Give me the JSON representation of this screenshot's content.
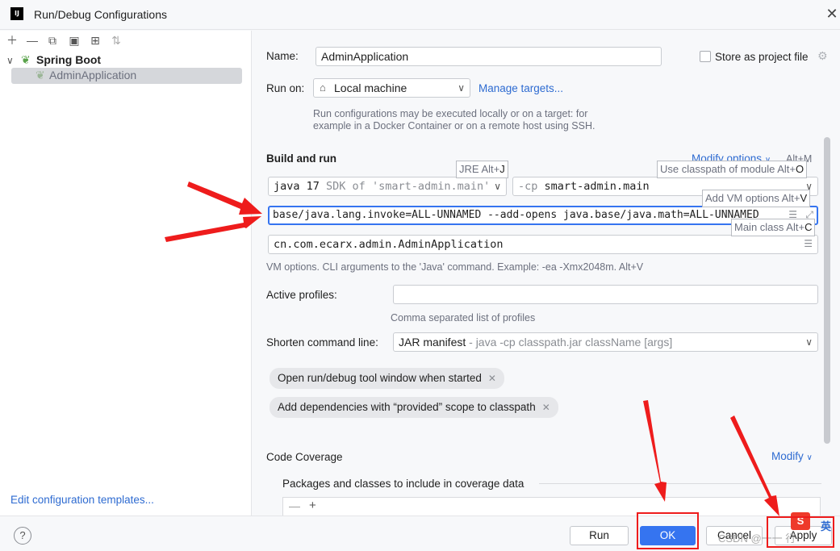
{
  "window": {
    "title": "Run/Debug Configurations",
    "logo_text": "IJ"
  },
  "left": {
    "tree_root": "Spring Boot",
    "tree_child": "AdminApplication",
    "edit_templates_link": "Edit configuration templates..."
  },
  "form": {
    "name_label": "Name:",
    "name_value": "AdminApplication",
    "store_label": "Store as project file",
    "run_on_label": "Run on:",
    "run_on_value": "Local machine",
    "manage_targets": "Manage targets...",
    "run_on_hint_1": "Run configurations may be executed locally or on a target: for",
    "run_on_hint_2": "example in a Docker Container or on a remote host using SSH.",
    "build_and_run": "Build and run",
    "modify_options": "Modify options",
    "modify_options_shortcut": "Alt+M",
    "jre_prefix": "java 17",
    "jre_suffix": "SDK of 'smart-admin.main'",
    "cp_prefix": "-cp",
    "cp_value": "smart-admin.main",
    "vm_options": "base/java.lang.invoke=ALL-UNNAMED  --add-opens java.base/java.math=ALL-UNNAMED",
    "main_class": "cn.com.ecarx.admin.AdminApplication",
    "vm_hint": "VM options. CLI arguments to the 'Java' command. Example: -ea -Xmx2048m. Alt+V",
    "active_profiles_label": "Active profiles:",
    "active_profiles_value": "",
    "profiles_hint": "Comma separated list of profiles",
    "shorten_label": "Shorten command line:",
    "shorten_value": "JAR manifest",
    "shorten_hint": "- java -cp classpath.jar className [args]",
    "chip_1": "Open run/debug tool window when started",
    "chip_2": "Add dependencies with “provided” scope to classpath",
    "code_coverage": "Code Coverage",
    "modify": "Modify",
    "packages_label": "Packages and classes to include in coverage data"
  },
  "tooltips": {
    "jre": "JRE Alt+",
    "jre_key": "J",
    "classpath": "Use classpath of module Alt+",
    "classpath_key": "O",
    "vm": "Add VM options Alt+",
    "vm_key": "V",
    "main": "Main class Alt+",
    "main_key": "C"
  },
  "buttons": {
    "run": "Run",
    "ok": "OK",
    "cancel": "Cancel",
    "apply": "Apply"
  },
  "watermark": "CSDN @一一 行",
  "ime_badge": "英",
  "colors": {
    "accent": "#3574f0",
    "link": "#2e6bd1",
    "annotation": "#ee1c1c",
    "selection": "#d5d7db"
  }
}
